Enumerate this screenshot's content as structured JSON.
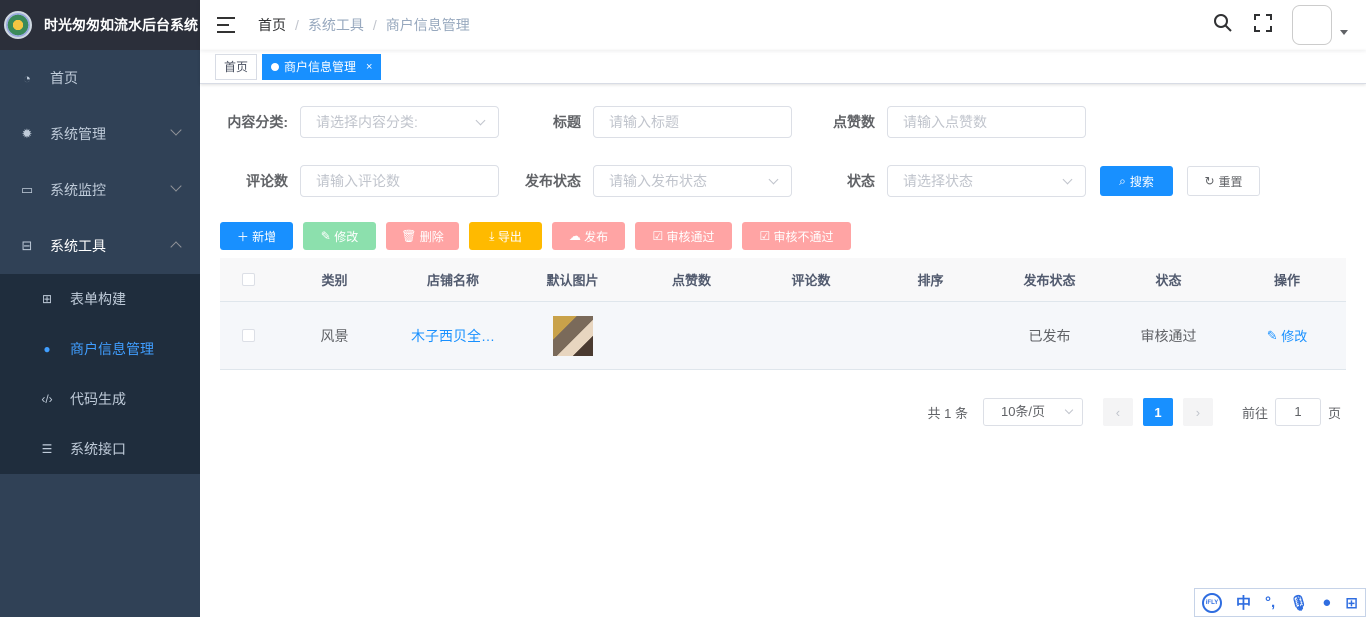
{
  "app": {
    "title": "时光匆匆如流水后台系统"
  },
  "sidebar": {
    "items": [
      {
        "label": "首页",
        "icon": "dashboard-icon"
      },
      {
        "label": "系统管理",
        "icon": "gear-icon"
      },
      {
        "label": "系统监控",
        "icon": "monitor-icon"
      },
      {
        "label": "系统工具",
        "icon": "toolbox-icon"
      }
    ],
    "submenu": [
      {
        "label": "表单构建",
        "icon": "grid-icon"
      },
      {
        "label": "商户信息管理",
        "icon": "user-icon"
      },
      {
        "label": "代码生成",
        "icon": "code-icon"
      },
      {
        "label": "系统接口",
        "icon": "sliders-icon"
      }
    ]
  },
  "breadcrumb": {
    "home": "首页",
    "sep": "/",
    "level2": "系统工具",
    "level3": "商户信息管理"
  },
  "tags": {
    "home": "首页",
    "active": "商户信息管理",
    "close": "×"
  },
  "form": {
    "category": {
      "label": "内容分类:",
      "placeholder": "请选择内容分类:"
    },
    "title": {
      "label": "标题",
      "placeholder": "请输入标题"
    },
    "likes": {
      "label": "点赞数",
      "placeholder": "请输入点赞数"
    },
    "comments": {
      "label": "评论数",
      "placeholder": "请输入评论数"
    },
    "publish_status": {
      "label": "发布状态",
      "placeholder": "请输入发布状态"
    },
    "status": {
      "label": "状态",
      "placeholder": "请选择状态"
    },
    "search": "搜索",
    "reset": "重置"
  },
  "toolbar": {
    "add": "新增",
    "edit": "修改",
    "delete": "删除",
    "export": "导出",
    "publish": "发布",
    "approve": "审核通过",
    "reject": "审核不通过"
  },
  "table": {
    "headers": [
      "类别",
      "店铺名称",
      "默认图片",
      "点赞数",
      "评论数",
      "排序",
      "发布状态",
      "状态",
      "操作"
    ],
    "rows": [
      {
        "category": "风景",
        "shop": "木子西贝全…",
        "likes": "",
        "comments": "",
        "sort": "",
        "publish_status": "已发布",
        "status": "审核通过",
        "action": "修改"
      }
    ]
  },
  "pagination": {
    "total": "共 1 条",
    "page_size": "10条/页",
    "current": "1",
    "goto": "前往",
    "goto_value": "1",
    "page_unit": "页"
  },
  "ime": {
    "lang": "中",
    "punct": "°,",
    "logo": "iFLY"
  },
  "colors": {
    "primary": "#1890ff",
    "sidebar": "#304156",
    "success": "#13ce66",
    "danger": "#ff4949",
    "warning": "#ffba00"
  }
}
